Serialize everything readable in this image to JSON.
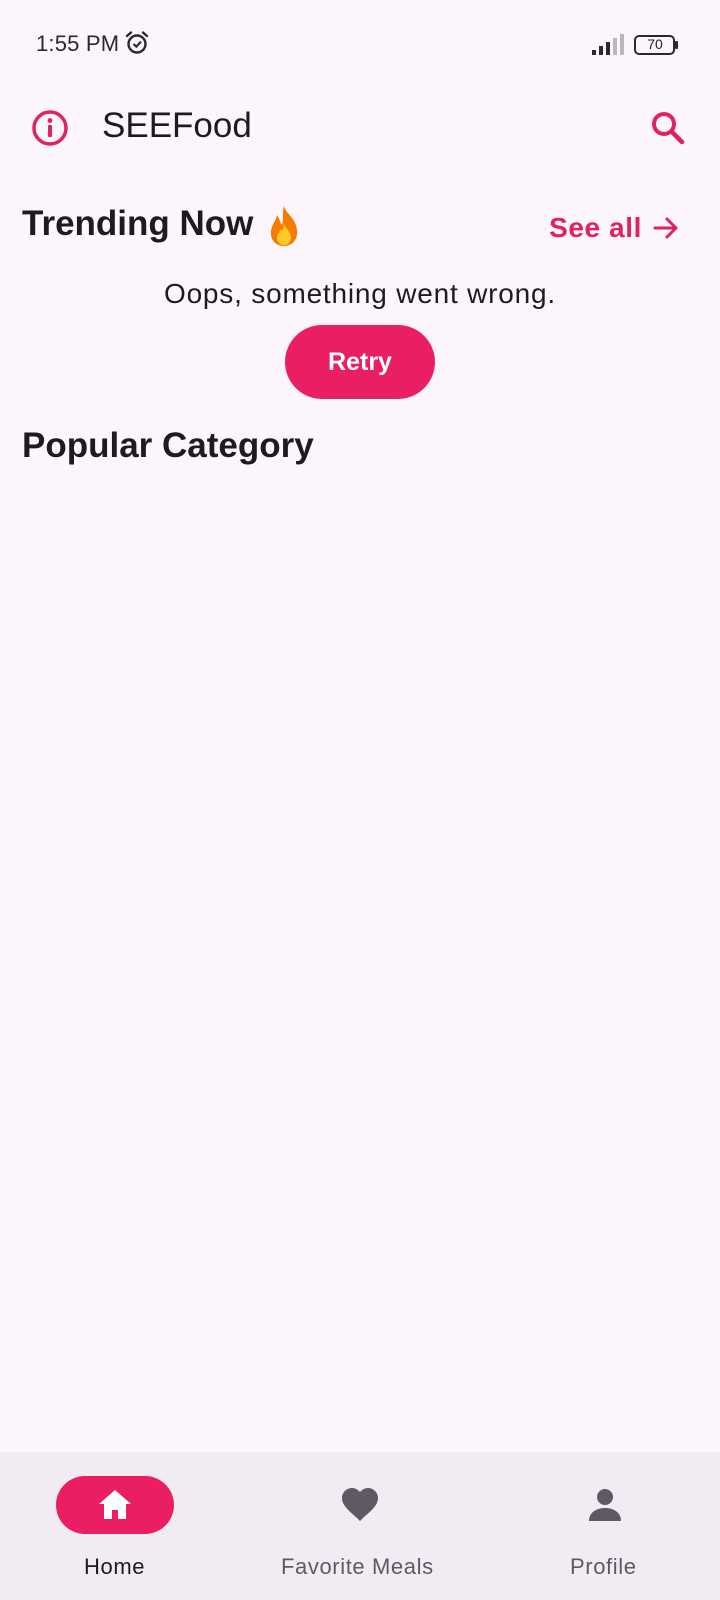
{
  "status_bar": {
    "time": "1:55 PM",
    "battery": "70",
    "icons": [
      "alarm-icon",
      "signal-icon",
      "battery-icon"
    ]
  },
  "app_bar": {
    "title": "SEEFood",
    "info_icon": "info-icon",
    "search_icon": "search-icon"
  },
  "trending": {
    "title": "Trending Now",
    "emoji_icon": "fire-icon",
    "see_all_label": "See all",
    "see_all_icon": "arrow-right-icon",
    "error_message": "Oops, something went wrong.",
    "retry_label": "Retry"
  },
  "popular": {
    "title": "Popular Category"
  },
  "bottom_nav": {
    "items": [
      {
        "label": "Home",
        "icon": "home-icon",
        "active": true
      },
      {
        "label": "Favorite Meals",
        "icon": "heart-icon",
        "active": false
      },
      {
        "label": "Profile",
        "icon": "person-icon",
        "active": false
      }
    ]
  },
  "colors": {
    "accent": "#e91e63",
    "background": "#fcf6fc",
    "nav_background": "#f1ecf4",
    "text": "#1d1b20",
    "inactive_icon": "#5e5a63"
  }
}
